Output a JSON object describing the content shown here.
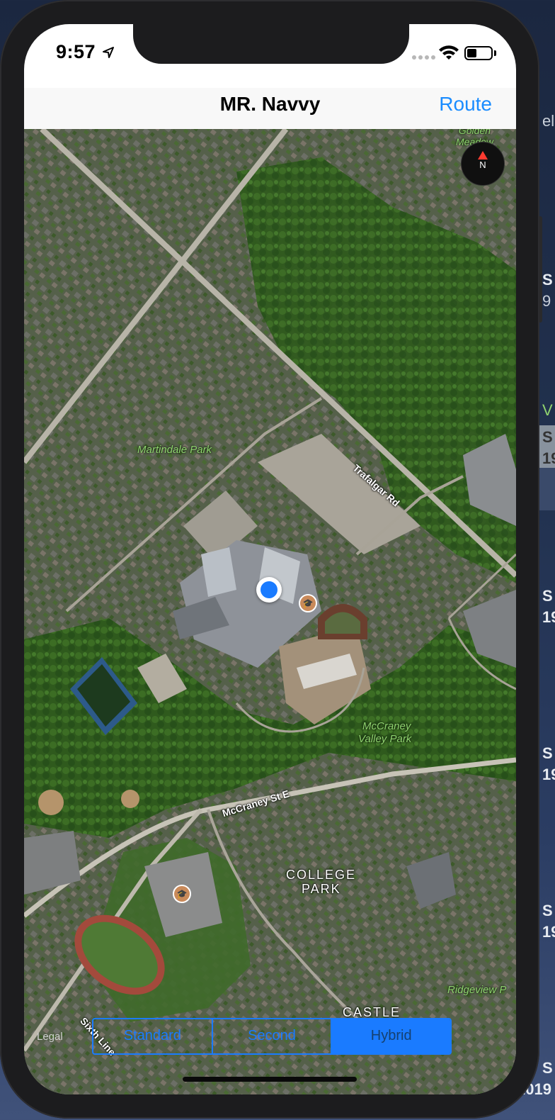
{
  "status_bar": {
    "time": "9:57",
    "icons": [
      "location-arrow-icon",
      "cellular-signal-icon",
      "wifi-icon",
      "battery-icon"
    ]
  },
  "navbar": {
    "title": "MR. Navvy",
    "right_button": "Route"
  },
  "map": {
    "type_shown": "satellite hybrid",
    "labels": {
      "golden_meadow": "Golden\nMeadow",
      "martindale_park": "Martindale Park",
      "trafalgar_rd": "Trafalgar Rd",
      "mccraney_valley_park_1": "McCraney",
      "mccraney_valley_park_2": "Valley Park",
      "mccraney_st": "McCraney St E",
      "college_park_1": "COLLEGE",
      "college_park_2": "PARK",
      "ridgeview": "Ridgeview P",
      "castle": "CASTLE",
      "sixth_line": "Sixth Line"
    },
    "compass_label": "N",
    "legal": "Legal"
  },
  "map_type_control": {
    "options": [
      "Standard",
      "Second",
      "Hybrid"
    ],
    "selected": "Hybrid"
  },
  "background_slivers": [
    "el",
    "S",
    "9",
    "V",
    "S",
    "19",
    "S",
    "19",
    "S",
    "19",
    "S",
    "19",
    "S",
    "2019"
  ],
  "colors": {
    "accent": "#1a7bff",
    "nav_link": "#1a8cff",
    "compass_needle": "#ff3b30",
    "park_label": "#8fd36f"
  }
}
